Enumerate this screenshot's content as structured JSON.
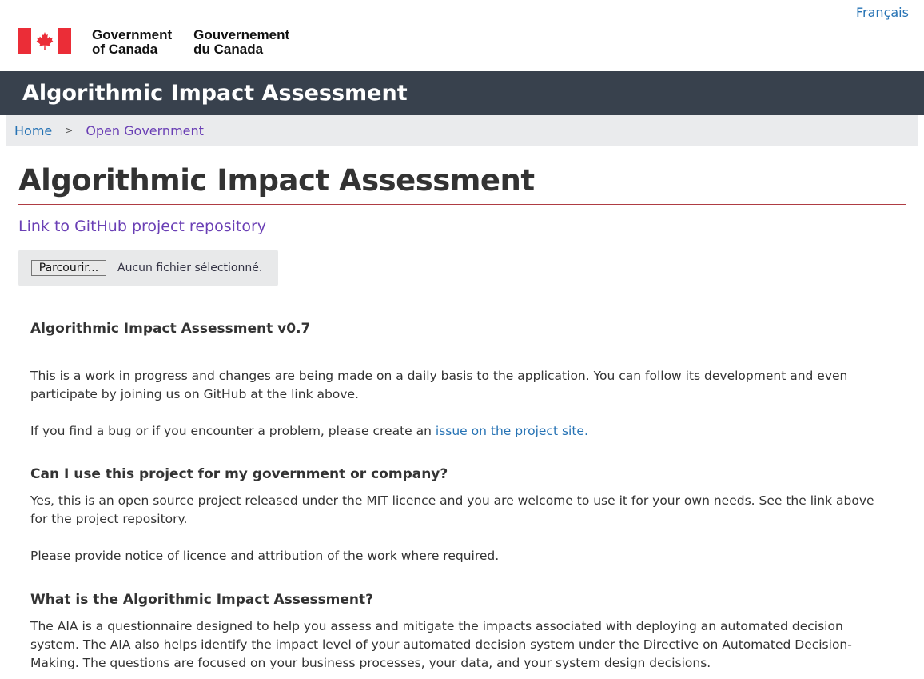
{
  "header": {
    "language_link": "Français",
    "signature_en_line1": "Government",
    "signature_en_line2": "of Canada",
    "signature_fr_line1": "Gouvernement",
    "signature_fr_line2": "du Canada"
  },
  "app_bar": {
    "title": "Algorithmic Impact Assessment"
  },
  "breadcrumb": {
    "items": [
      "Home",
      "Open Government"
    ],
    "separator": ">"
  },
  "page": {
    "title": "Algorithmic Impact Assessment",
    "github_link": "Link to GitHub project repository"
  },
  "file_input": {
    "button_label": "Parcourir...",
    "status": "Aucun fichier sélectionné."
  },
  "content": {
    "version_heading": "Algorithmic Impact Assessment v0.7",
    "intro_p1": "This is a work in progress and changes are being made on a daily basis to the application. You can follow its development and even participate by joining us on GitHub at the link above.",
    "intro_p2_text": "If you find a bug or if you encounter a problem, please create an ",
    "intro_p2_link": "issue on the project site.",
    "faq1_heading": "Can I use this project for my government or company?",
    "faq1_p1": "Yes, this is an open source project released under the MIT licence and you are welcome to use it for your own needs. See the link above for the project repository.",
    "faq1_p2": "Please provide notice of licence and attribution of the work where required.",
    "faq2_heading": "What is the Algorithmic Impact Assessment?",
    "faq2_p1": "The AIA is a questionnaire designed to help you assess and mitigate the impacts associated with deploying an automated decision system. The AIA also helps identify the impact level of your automated decision system under the Directive on Automated Decision-Making. The questions are focused on your business processes, your data, and your system design decisions."
  },
  "colors": {
    "flag_red": "#eb2d37",
    "app_bar_bg": "#38414d",
    "link_blue": "#2572b4",
    "visited_purple": "#6a3fb5",
    "title_rule": "#af3c43"
  }
}
